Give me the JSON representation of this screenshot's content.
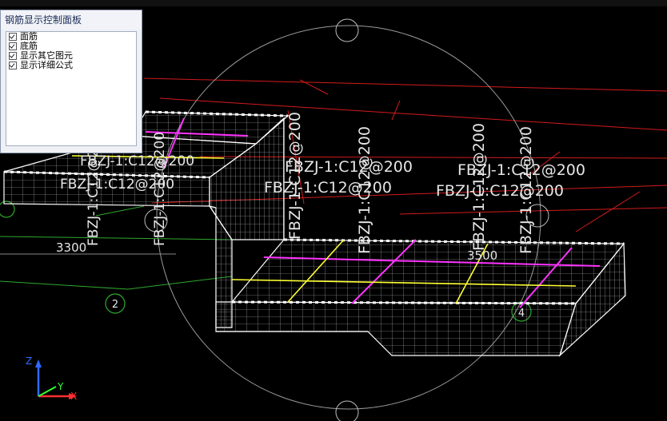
{
  "panel": {
    "title": "钢筋显示控制面板",
    "options": [
      {
        "label": "面筋",
        "checked": true
      },
      {
        "label": "底筋",
        "checked": true
      },
      {
        "label": "显示其它图元",
        "checked": true
      },
      {
        "label": "显示详细公式",
        "checked": true
      }
    ]
  },
  "labels": {
    "h1": "FBZJ-1:C12@200",
    "h2": "FBZJ-1:C12@200",
    "h3": "FBZJ-1:C12@200",
    "h4": "FBZJ-1:C12@200",
    "h5": "FBZJ-1:C12@200",
    "h6": "FBZJ-1:C12@200",
    "v1": "FBZJ-1:C12@200",
    "v2": "FBZJ-1:C12@200",
    "v3": "FBZJ-1:C12@200",
    "v4": "FBZJ-1:C12@200",
    "v5": "FBZJ-1:C12@200",
    "v6": "FBZJ-1:C12@200"
  },
  "dims": {
    "d1": "3300",
    "d2": "3500"
  },
  "axis_marks": {
    "m2": "2",
    "m4": "4"
  },
  "triad": {
    "x": "X",
    "y": "Y",
    "z": "Z"
  },
  "colors": {
    "bg": "#000000",
    "grid_red": "#d21b1b",
    "grid_green": "#2fa82f",
    "rebar_magenta": "#ff33ff",
    "rebar_yellow": "#ffff33",
    "text": "#e6e6e6"
  }
}
